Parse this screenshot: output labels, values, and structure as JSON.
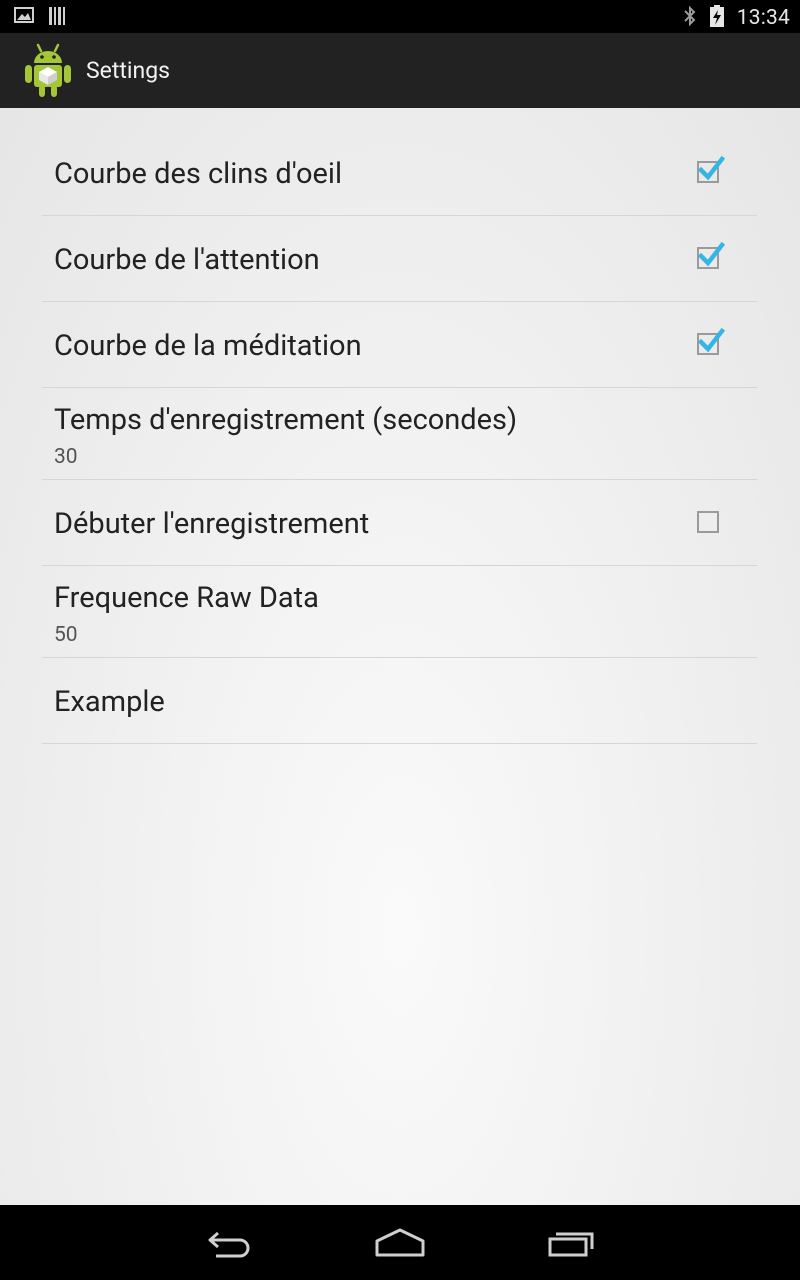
{
  "status_bar": {
    "time": "13:34",
    "icons": [
      "image-notification-icon",
      "barcode-notification-icon",
      "bluetooth-icon",
      "battery-charging-icon"
    ]
  },
  "action_bar": {
    "title": "Settings",
    "icon": "android-app-icon"
  },
  "preferences": [
    {
      "title": "Courbe des clins d'oeil",
      "type": "checkbox",
      "checked": true
    },
    {
      "title": "Courbe de l'attention",
      "type": "checkbox",
      "checked": true
    },
    {
      "title": "Courbe de la méditation",
      "type": "checkbox",
      "checked": true
    },
    {
      "title": "Temps d'enregistrement (secondes)",
      "type": "edittext",
      "summary": "30"
    },
    {
      "title": "Débuter l'enregistrement",
      "type": "checkbox",
      "checked": false
    },
    {
      "title": "Frequence Raw Data",
      "type": "edittext",
      "summary": "50"
    },
    {
      "title": "Example",
      "type": "plain"
    }
  ],
  "nav_bar": {
    "buttons": [
      "back-icon",
      "home-icon",
      "recents-icon"
    ]
  },
  "colors": {
    "accent": "#33b5e5",
    "action_bar_bg": "#222222",
    "status_bar_bg": "#000000"
  }
}
